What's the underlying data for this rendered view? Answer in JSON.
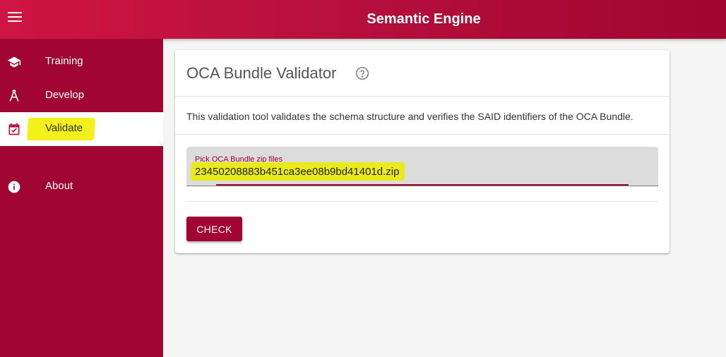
{
  "header": {
    "title": "Semantic Engine",
    "menu_icon": "hamburger-icon"
  },
  "sidebar": {
    "items": [
      {
        "label": "Training",
        "icon": "graduation-cap-icon"
      },
      {
        "label": "Develop",
        "icon": "compass-icon"
      },
      {
        "label": "Validate",
        "icon": "checkbox-calendar-icon",
        "active": true
      },
      {
        "label": "About",
        "icon": "info-icon"
      }
    ]
  },
  "card": {
    "title": "OCA Bundle Validator",
    "help_icon": "help-circle-icon",
    "description": "This validation tool validates the schema structure and verifies the SAID identifiers of the OCA Bundle.",
    "file_field": {
      "label": "Pick OCA Bundle zip files",
      "value": "23450208883b451ca3ee08b9bd41401d.zip"
    },
    "check_button": "CHECK"
  },
  "colors": {
    "primary": "#a10633",
    "header_gradient_start": "#cf1543",
    "highlight": "#f4f01b"
  }
}
